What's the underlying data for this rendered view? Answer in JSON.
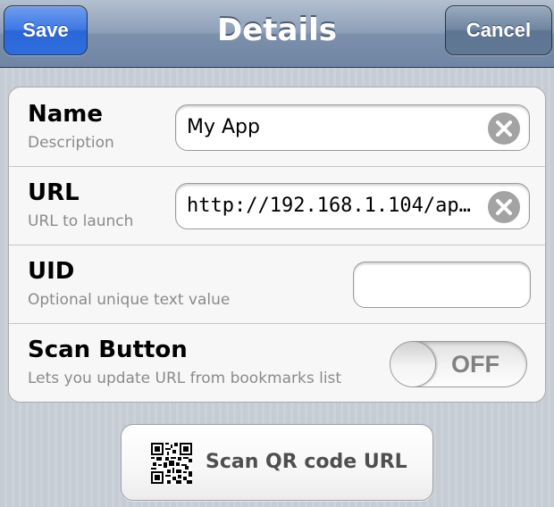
{
  "navbar": {
    "title": "Details",
    "save_label": "Save",
    "cancel_label": "Cancel"
  },
  "form": {
    "name": {
      "label": "Name",
      "sublabel": "Description",
      "value": "My App"
    },
    "url": {
      "label": "URL",
      "sublabel": "URL to launch",
      "value": "http://192.168.1.104/ap…"
    },
    "uid": {
      "label": "UID",
      "sublabel": "Optional unique text value",
      "value": ""
    },
    "scan_button": {
      "label": "Scan Button",
      "sublabel": "Lets you update URL from bookmarks list",
      "toggle_text": "OFF",
      "enabled": false
    }
  },
  "scan_qr": {
    "label": "Scan QR code URL",
    "icon": "qr-code-icon"
  },
  "colors": {
    "save_button": "#3d78e4",
    "navbar": "#8d9fb8",
    "background": "#c5ccd4"
  }
}
